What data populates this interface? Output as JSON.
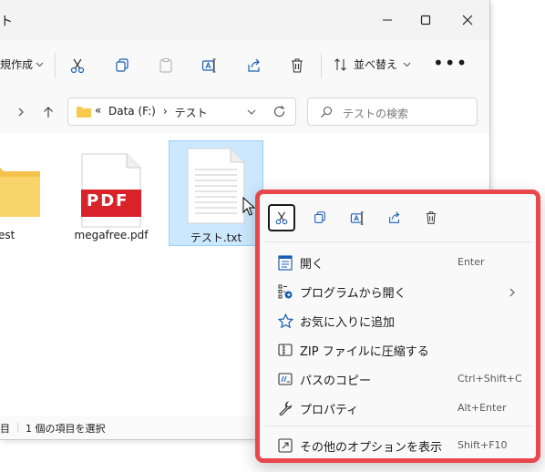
{
  "window": {
    "title": "ト",
    "controls": {
      "minimize": "—",
      "maximize": "□",
      "close": "✕"
    }
  },
  "toolbar": {
    "new_label": "規作成",
    "sort_label": "並べ替え",
    "more_label": "•••"
  },
  "address": {
    "prefix": "«",
    "crumbs": [
      "Data (F:)",
      "テスト"
    ],
    "separator": "›"
  },
  "search": {
    "placeholder": "テストの検索"
  },
  "files": [
    {
      "name": "est",
      "type": "folder"
    },
    {
      "name": "megafree.pdf",
      "type": "pdf",
      "badge": "PDF"
    },
    {
      "name": "テスト.txt",
      "type": "text",
      "selected": true
    }
  ],
  "status": {
    "left": "目",
    "selection": "1 個の項目を選択"
  },
  "context_menu": {
    "icons": [
      "cut-icon",
      "copy-icon",
      "rename-icon",
      "share-icon",
      "delete-icon"
    ],
    "items": [
      {
        "label": "開く",
        "shortcut": "Enter"
      },
      {
        "label": "プログラムから開く",
        "submenu": "›"
      },
      {
        "label": "お気に入りに追加"
      },
      {
        "label": "ZIP ファイルに圧縮する"
      },
      {
        "label": "パスのコピー",
        "shortcut": "Ctrl+Shift+C"
      },
      {
        "label": "プロパティ",
        "shortcut": "Alt+Enter"
      },
      {
        "label": "その他のオプションを表示",
        "shortcut": "Shift+F10"
      }
    ]
  },
  "colors": {
    "highlight_border": "#e8474b",
    "selection_fill": "#cce8ff",
    "folder": "#f7c94c",
    "pdf_red": "#d9232a",
    "accent_blue": "#1a5fb4"
  }
}
